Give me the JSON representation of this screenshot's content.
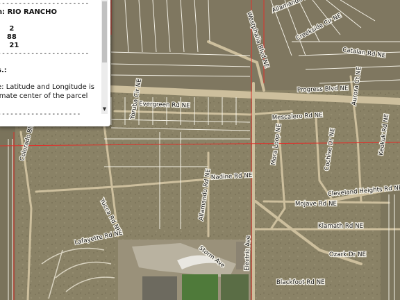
{
  "map": {
    "roads": [
      "Westphalia Blvd NE",
      "Catalan Rd NE",
      "Progress Blvd NE",
      "Evergreen Rd NE",
      "Yoruba Cir NE",
      "Mescalero Rd NE",
      "Mora Loop NE",
      "Cochise Dr NE",
      "Keokuk Rd NE",
      "Nadine Rd NE",
      "Cleveland Heights Rd NE",
      "Mojave Rd NE",
      "Klamath Rd NE",
      "Ozark Dr NE",
      "Blackfoot Rd NE",
      "Allamando Rd NE",
      "Yucca Rd NE",
      "Lafayette Rd NE",
      "Storm Ave",
      "Electric Ave",
      "Colorado Blvd NE",
      "Allamando Rd NE",
      "Creekside Cir NE",
      "Aurora Ct NE"
    ],
    "colors": {
      "desert": "#8a8266",
      "road": "#c9bc9a",
      "parcel_line": "#f8f6ef",
      "boundary": "#e0302a"
    }
  },
  "popup": {
    "lines": [
      "----------------------",
      "n: RIO RANCHO",
      "",
      "     2",
      "    88",
      "     21",
      "----------------------",
      "",
      "s.:",
      "",
      "e: Latitude and Longitude is",
      "imate center of the parcel",
      "",
      "--------------------"
    ]
  }
}
